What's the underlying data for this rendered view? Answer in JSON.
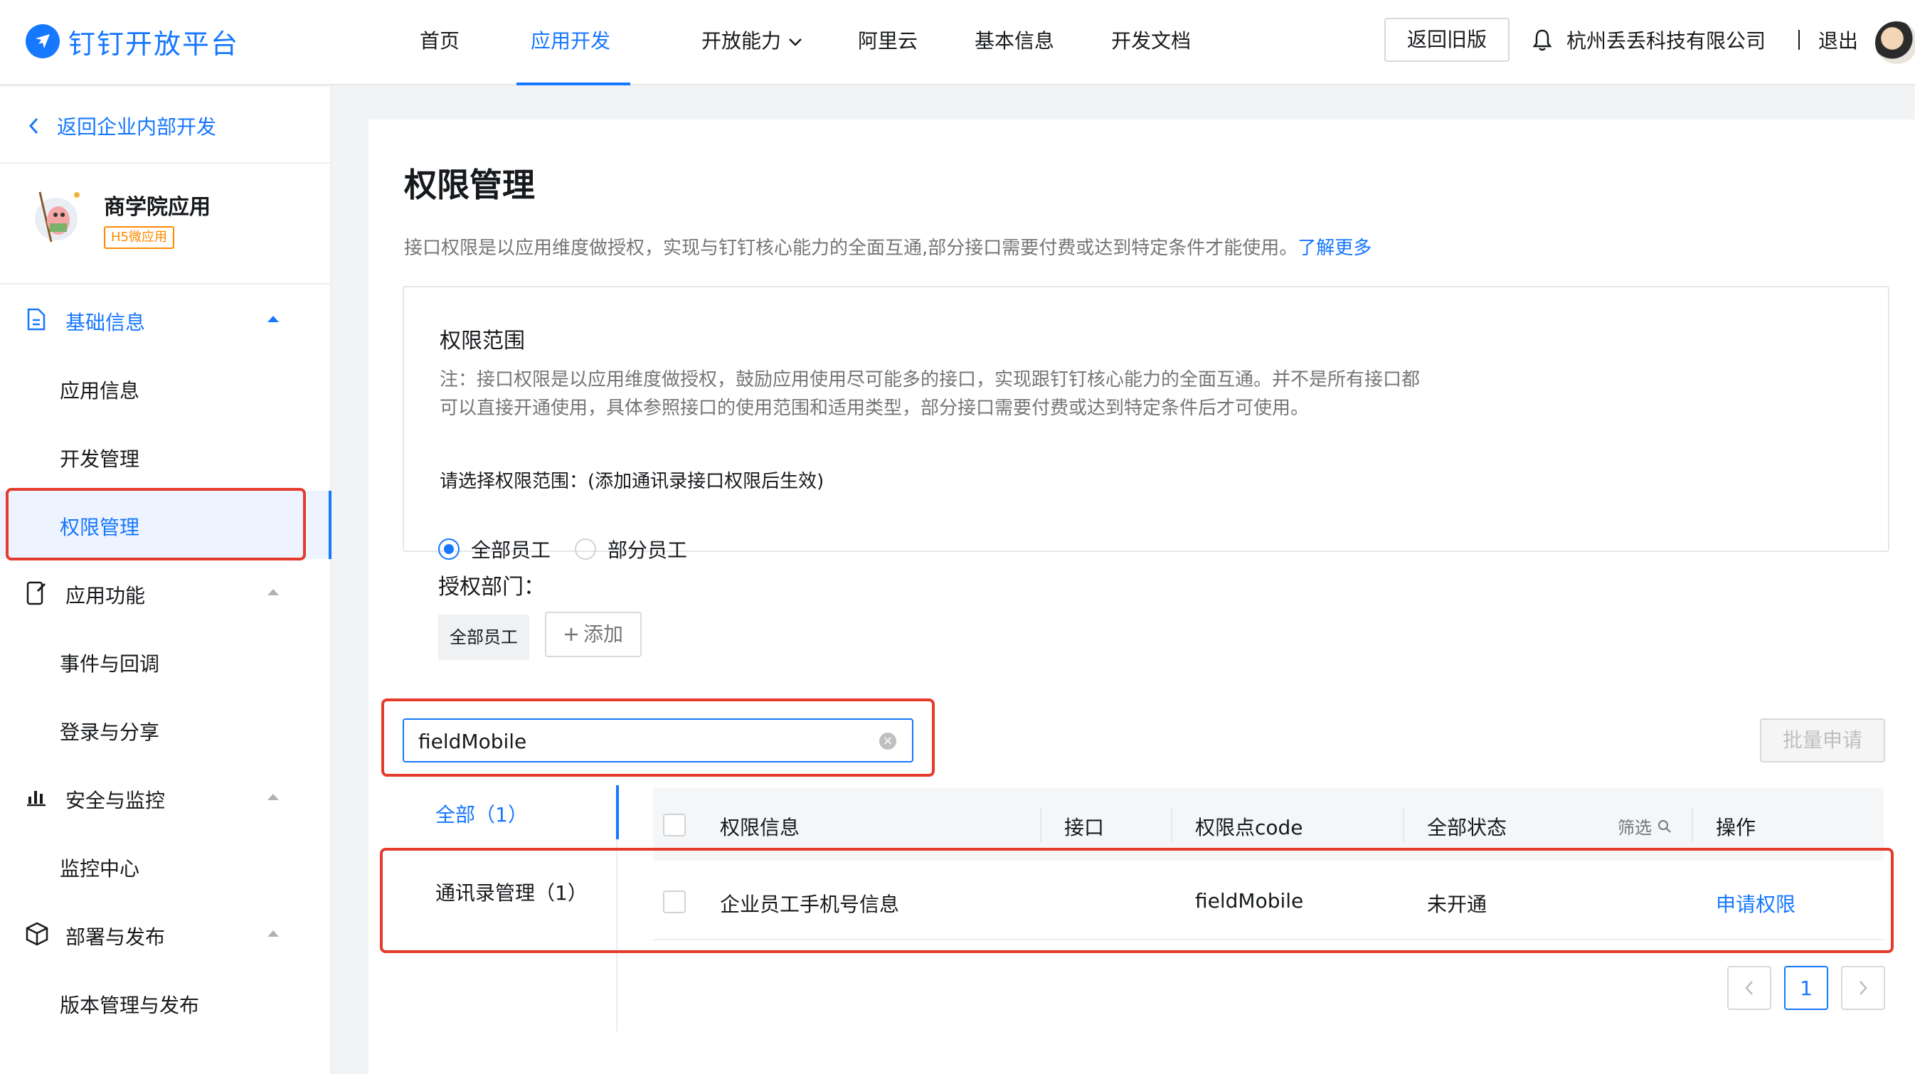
{
  "topbar": {
    "logo_text": "钉钉开放平台",
    "nav": [
      {
        "label": "首页"
      },
      {
        "label": "应用开发",
        "active": true,
        "has_dropdown": true
      },
      {
        "label": "开放能力",
        "has_dropdown": true
      },
      {
        "label": "阿里云"
      },
      {
        "label": "基本信息"
      },
      {
        "label": "开发文档"
      }
    ],
    "old_version_button": "返回旧版",
    "company": "杭州丢丢科技有限公司",
    "separator": "|",
    "logout": "退出"
  },
  "sidebar": {
    "back_label": "返回企业内部开发",
    "app": {
      "name": "商学院应用",
      "tag": "H5微应用"
    },
    "groups": [
      {
        "label": "基础信息",
        "icon": "document-icon",
        "expanded": true,
        "items": [
          "应用信息",
          "开发管理",
          "权限管理"
        ]
      },
      {
        "label": "应用功能",
        "icon": "phone-edit-icon",
        "items": [
          "事件与回调",
          "登录与分享"
        ]
      },
      {
        "label": "安全与监控",
        "icon": "bar-chart-icon",
        "items": [
          "监控中心"
        ]
      },
      {
        "label": "部署与发布",
        "icon": "cube-icon",
        "items": [
          "版本管理与发布"
        ]
      }
    ],
    "active_item": "权限管理"
  },
  "main": {
    "title": "权限管理",
    "description": "接口权限是以应用维度做授权，实现与钉钉核心能力的全面互通,部分接口需要付费或达到特定条件才能使用。",
    "learn_more": "了解更多",
    "scope": {
      "title": "权限范围",
      "note": "注：接口权限是以应用维度做授权，鼓励应用使用尽可能多的接口，实现跟钉钉核心能力的全面互通。并不是所有接口都可以直接开通使用，具体参照接口的使用范围和适用类型，部分接口需要付费或达到特定条件后才可使用。",
      "prompt": "请选择权限范围：(添加通讯录接口权限后生效)",
      "options": [
        "全部员工",
        "部分员工"
      ],
      "selected": "全部员工",
      "auth_label": "授权部门：",
      "dept_chip": "全部员工",
      "add_label": "添加"
    },
    "search": {
      "value": "fieldMobile",
      "placeholder": ""
    },
    "batch_button": "批量申请",
    "categories": [
      {
        "label": "全部（1）",
        "active": true
      },
      {
        "label": "通讯录管理（1）"
      }
    ],
    "table": {
      "headers": [
        "权限信息",
        "接口",
        "权限点code",
        "全部状态",
        "操作"
      ],
      "filter_label": "筛选",
      "rows": [
        {
          "name": "企业员工手机号信息",
          "api": "",
          "code": "fieldMobile",
          "status": "未开通",
          "action": "申请权限"
        }
      ]
    },
    "pagination": {
      "current": "1"
    }
  },
  "colors": {
    "primary": "#1677ff",
    "highlight_box": "#e53b2c",
    "tag": "#ff8a00"
  }
}
